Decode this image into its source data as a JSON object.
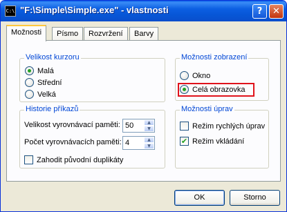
{
  "window": {
    "title": "\"F:\\Simple\\Simple.exe\" - vlastnosti",
    "icon_text": "C:\\",
    "help_glyph": "?",
    "close_glyph": "✕"
  },
  "tabs": [
    {
      "label": "Možnosti",
      "active": true
    },
    {
      "label": "Písmo",
      "active": false
    },
    {
      "label": "Rozvržení",
      "active": false
    },
    {
      "label": "Barvy",
      "active": false
    }
  ],
  "cursor_size": {
    "legend": "Velikost kurzoru",
    "options": [
      {
        "label": "Malá",
        "selected": true
      },
      {
        "label": "Střední",
        "selected": false
      },
      {
        "label": "Velká",
        "selected": false
      }
    ]
  },
  "display_options": {
    "legend": "Možnosti zobrazení",
    "options": [
      {
        "label": "Okno",
        "selected": false
      },
      {
        "label": "Celá obrazovka",
        "selected": true
      }
    ]
  },
  "command_history": {
    "legend": "Historie příkazů",
    "buffer_size_label": "Velikost vyrovnávací paměti:",
    "buffer_size_value": "50",
    "buffer_count_label": "Počet vyrovnávacích paměti:",
    "buffer_count_value": "4",
    "discard_duplicates_label": "Zahodit původní duplikáty",
    "discard_duplicates_checked": false
  },
  "edit_options": {
    "legend": "Možnosti úprav",
    "quick_edit_label": "Režim rychlých úprav",
    "quick_edit_checked": false,
    "insert_mode_label": "Režim vkládání",
    "insert_mode_checked": true
  },
  "buttons": {
    "ok": "OK",
    "cancel": "Storno"
  },
  "colors": {
    "title_bar": "#0756d6",
    "legend_text": "#0046d5",
    "highlight": "#e0121b"
  }
}
